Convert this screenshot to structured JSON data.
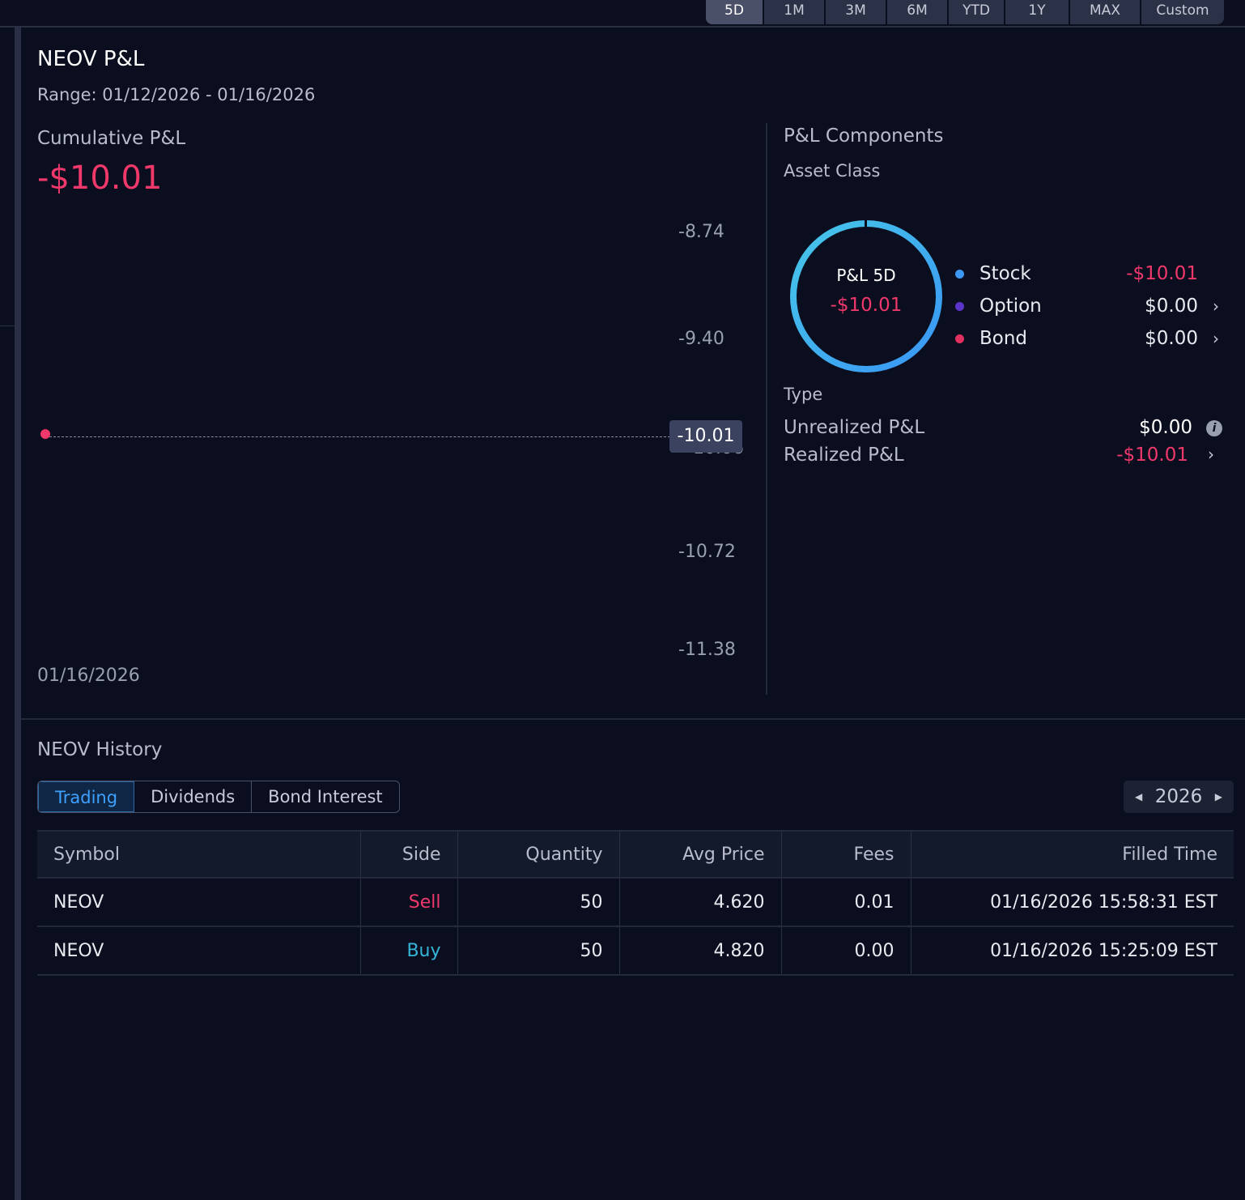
{
  "range_tabs": [
    "5D",
    "1M",
    "3M",
    "6M",
    "YTD",
    "1Y",
    "MAX",
    "Custom"
  ],
  "active_range": "5D",
  "header": {
    "title": "NEOV P&L",
    "range": "Range: 01/12/2026 - 01/16/2026"
  },
  "cumulative": {
    "label": "Cumulative P&L",
    "value": "-$10.01"
  },
  "chart_data": {
    "type": "line",
    "x": [
      "01/16/2026"
    ],
    "values": [
      -10.01
    ],
    "y_ticks": [
      "-8.74",
      "-9.40",
      "-10.06",
      "-10.72",
      "-11.38"
    ],
    "ylim": [
      -11.38,
      -8.74
    ],
    "current_label": "-10.01",
    "xlabel_tick": "01/16/2026",
    "grid": false
  },
  "components": {
    "title": "P&L Components",
    "asset_class_label": "Asset Class",
    "donut_title": "P&L 5D",
    "donut_value": "-$10.01",
    "legend": [
      {
        "name": "Stock",
        "value": "-$10.01",
        "color": "#3d97f5",
        "value_color": "#f0386b",
        "chevron": false
      },
      {
        "name": "Option",
        "value": "$0.00",
        "color": "#5b35c9",
        "value_color": "#ffffff",
        "chevron": true
      },
      {
        "name": "Bond",
        "value": "$0.00",
        "color": "#e0305f",
        "value_color": "#ffffff",
        "chevron": true
      }
    ],
    "type_label": "Type",
    "unrealized_label": "Unrealized P&L",
    "unrealized_value": "$0.00",
    "realized_label": "Realized P&L",
    "realized_value": "-$10.01"
  },
  "history": {
    "title": "NEOV History",
    "tabs": [
      "Trading",
      "Dividends",
      "Bond Interest"
    ],
    "year": "2026",
    "columns": [
      "Symbol",
      "Side",
      "Quantity",
      "Avg Price",
      "Fees",
      "Filled Time"
    ],
    "rows": [
      {
        "symbol": "NEOV",
        "side": "Sell",
        "quantity": "50",
        "avg_price": "4.620",
        "fees": "0.01",
        "filled_time": "01/16/2026 15:58:31 EST"
      },
      {
        "symbol": "NEOV",
        "side": "Buy",
        "quantity": "50",
        "avg_price": "4.820",
        "fees": "0.00",
        "filled_time": "01/16/2026 15:25:09 EST"
      }
    ]
  }
}
